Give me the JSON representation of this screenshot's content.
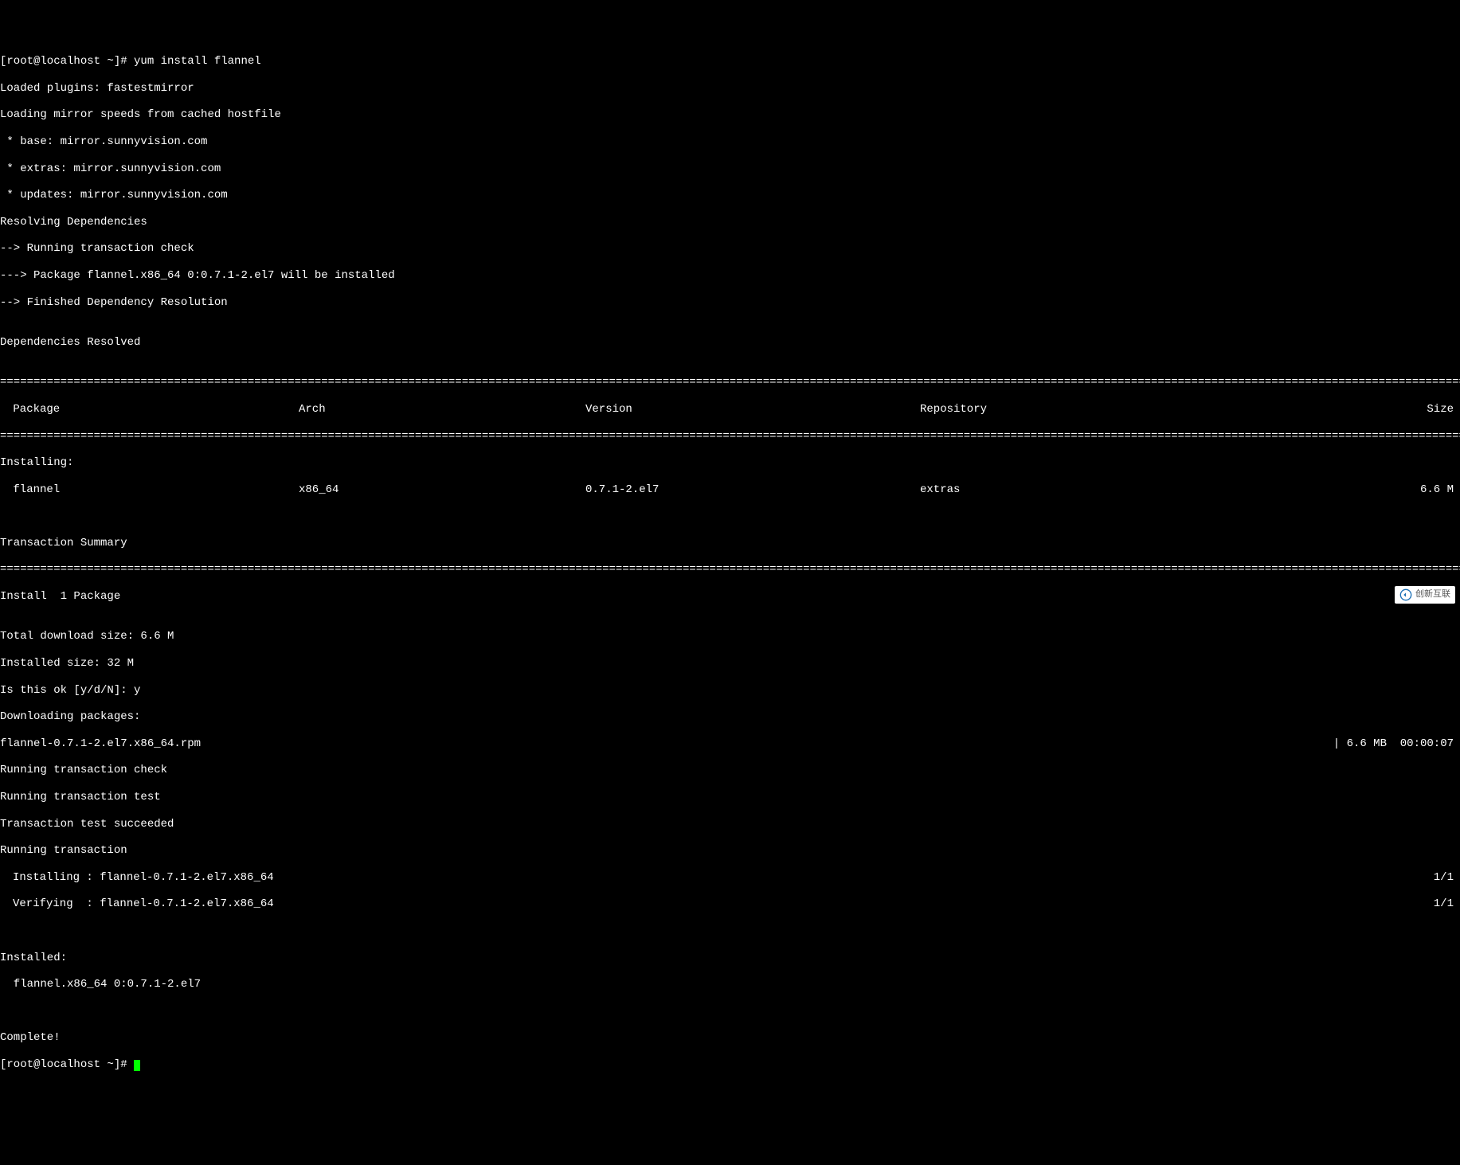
{
  "prompt1": "[root@localhost ~]# ",
  "command": "yum install flannel",
  "preamble": [
    "Loaded plugins: fastestmirror",
    "Loading mirror speeds from cached hostfile",
    " * base: mirror.sunnyvision.com",
    " * extras: mirror.sunnyvision.com",
    " * updates: mirror.sunnyvision.com",
    "Resolving Dependencies",
    "--> Running transaction check",
    "---> Package flannel.x86_64 0:0.7.1-2.el7 will be installed",
    "--> Finished Dependency Resolution",
    "",
    "Dependencies Resolved",
    ""
  ],
  "rule": "===================================================================================================================================================================================================================================",
  "table_header": {
    "package": " Package",
    "arch": "Arch",
    "version": "Version",
    "repository": "Repository",
    "size": "Size"
  },
  "installing_label": "Installing:",
  "table_row": {
    "package": " flannel",
    "arch": "x86_64",
    "version": "0.7.1-2.el7",
    "repository": "extras",
    "size": "6.6 M"
  },
  "transaction_summary_label": "Transaction Summary",
  "install_count": "Install  1 Package",
  "totals": [
    "",
    "Total download size: 6.6 M",
    "Installed size: 32 M",
    "Is this ok [y/d/N]: y",
    "Downloading packages:"
  ],
  "download": {
    "file": "flannel-0.7.1-2.el7.x86_64.rpm",
    "progress": "| 6.6 MB  00:00:07"
  },
  "post_download": [
    "Running transaction check",
    "Running transaction test",
    "Transaction test succeeded",
    "Running transaction"
  ],
  "installing_step": {
    "label": "Installing : flannel-0.7.1-2.el7.x86_64",
    "count": "1/1"
  },
  "verifying_step": {
    "label": "Verifying  : flannel-0.7.1-2.el7.x86_64",
    "count": "1/1"
  },
  "installed_label": "Installed:",
  "installed_pkg": "  flannel.x86_64 0:0.7.1-2.el7",
  "complete": "Complete!",
  "prompt2": "[root@localhost ~]# ",
  "watermark": "创新互联"
}
